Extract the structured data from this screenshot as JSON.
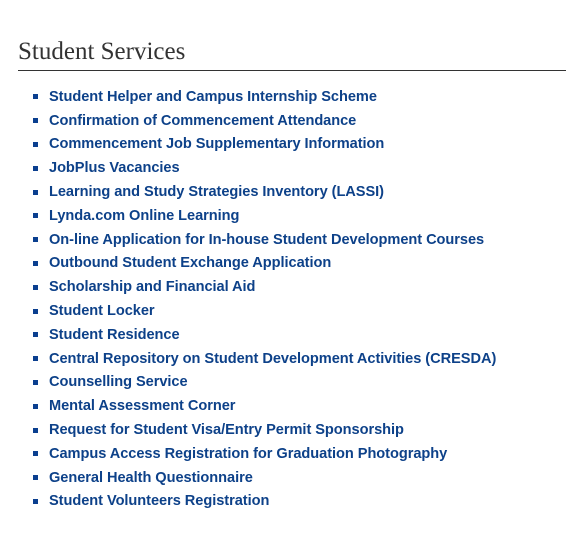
{
  "section": {
    "title": "Student Services"
  },
  "colors": {
    "link": "#0d4189",
    "bullet": "#0a3f8f",
    "title": "#333333",
    "divider": "#333333"
  },
  "items": [
    {
      "label": "Student Helper and Campus Internship Scheme"
    },
    {
      "label": "Confirmation of Commencement Attendance"
    },
    {
      "label": "Commencement Job Supplementary Information"
    },
    {
      "label": "JobPlus Vacancies"
    },
    {
      "label": "Learning and Study Strategies Inventory (LASSI)"
    },
    {
      "label": "Lynda.com Online Learning"
    },
    {
      "label": "On-line Application for In-house Student Development Courses"
    },
    {
      "label": "Outbound Student Exchange Application"
    },
    {
      "label": "Scholarship and Financial Aid"
    },
    {
      "label": "Student Locker"
    },
    {
      "label": "Student Residence"
    },
    {
      "label": "Central Repository on Student Development Activities (CRESDA)"
    },
    {
      "label": "Counselling Service"
    },
    {
      "label": "Mental Assessment Corner"
    },
    {
      "label": "Request for Student Visa/Entry Permit Sponsorship"
    },
    {
      "label": "Campus Access Registration for Graduation Photography"
    },
    {
      "label": "General Health Questionnaire"
    },
    {
      "label": "Student Volunteers Registration"
    }
  ]
}
